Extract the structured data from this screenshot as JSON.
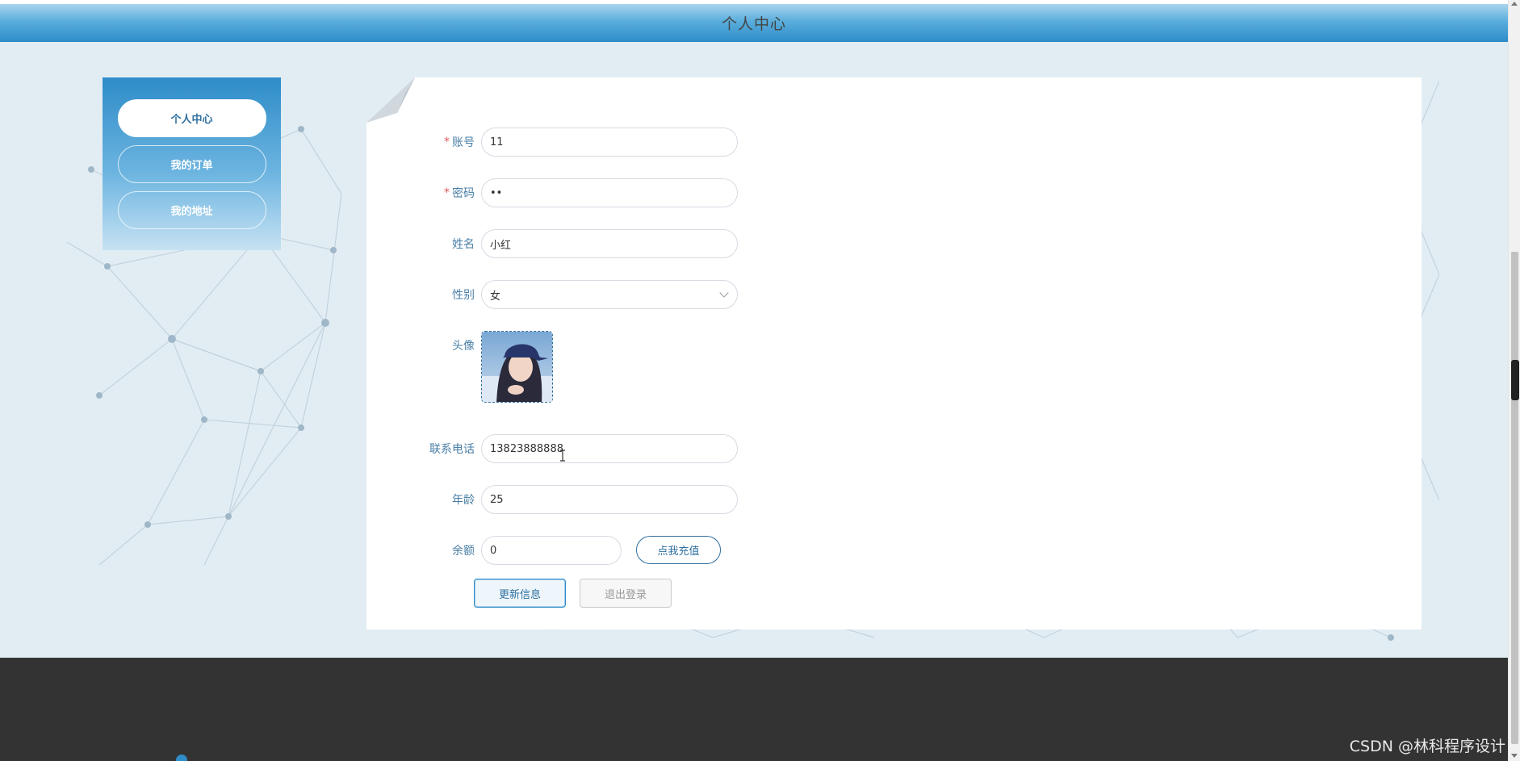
{
  "header": {
    "title": "个人中心"
  },
  "sidebar": {
    "items": [
      {
        "label": "个人中心",
        "active": true
      },
      {
        "label": "我的订单",
        "active": false
      },
      {
        "label": "我的地址",
        "active": false
      }
    ]
  },
  "form": {
    "account": {
      "label": "账号",
      "value": "11",
      "required": true
    },
    "password": {
      "label": "密码",
      "value": "••",
      "required": true
    },
    "name": {
      "label": "姓名",
      "value": "小红"
    },
    "gender": {
      "label": "性别",
      "value": "女"
    },
    "avatar": {
      "label": "头像"
    },
    "phone": {
      "label": "联系电话",
      "value": "13823888888"
    },
    "age": {
      "label": "年龄",
      "value": "25"
    },
    "balance": {
      "label": "余额",
      "value": "0"
    }
  },
  "buttons": {
    "recharge": "点我充值",
    "update": "更新信息",
    "logout": "退出登录"
  },
  "footer": {
    "watermark": "CSDN @林科程序设计"
  },
  "colors": {
    "primary": "#2e8cc8",
    "label": "#4a7fa7",
    "footer": "#333333",
    "required": "#e35b5b"
  }
}
